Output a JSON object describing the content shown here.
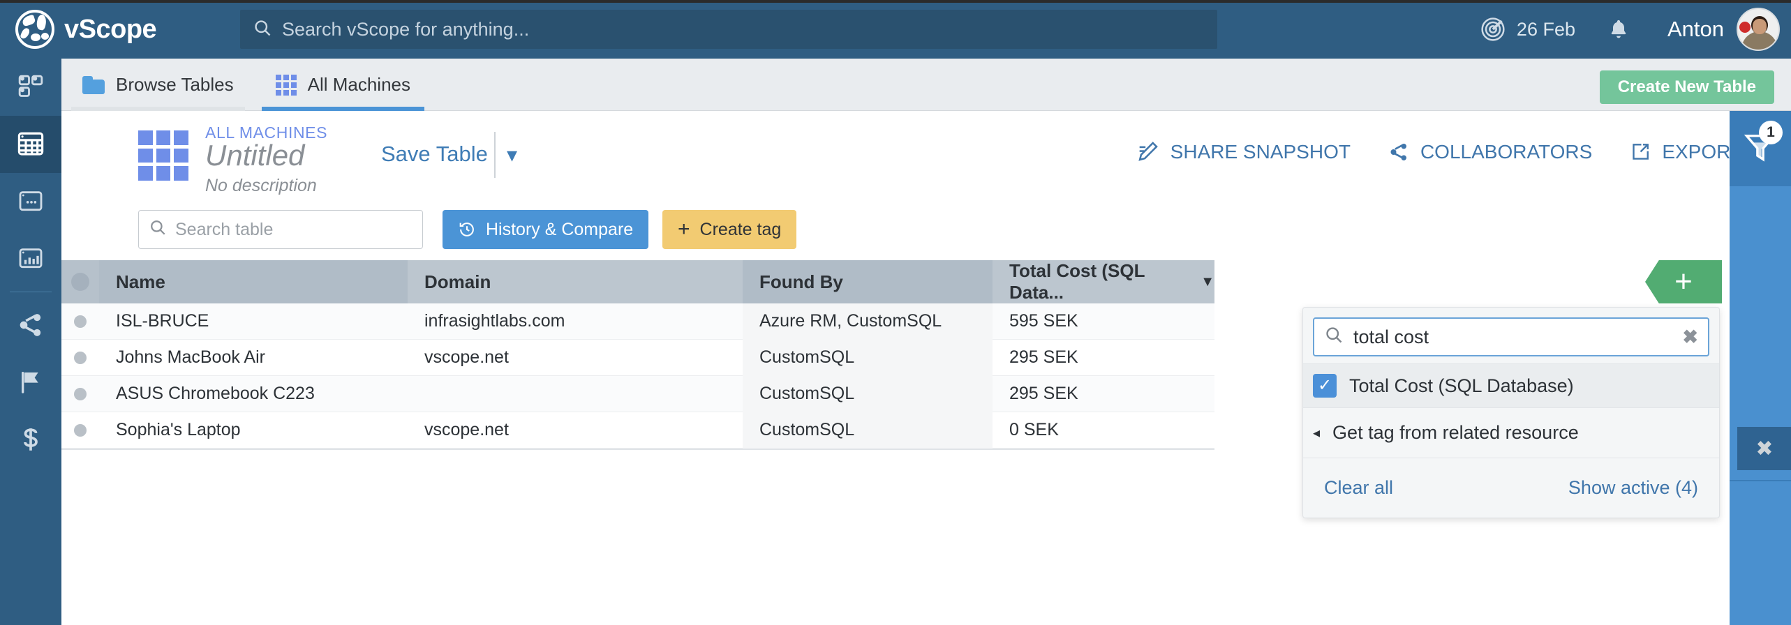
{
  "app": {
    "brand": "vScope",
    "logo_icon": "vscope-globe-logo"
  },
  "header": {
    "search_placeholder": "Search vScope for anything...",
    "search_icon": "search-icon",
    "radar_icon": "radar-icon",
    "date": "26 Feb",
    "bell_icon": "bell-icon",
    "user_name": "Anton",
    "avatar_icon": "user-avatar"
  },
  "sidebar": {
    "items": [
      {
        "name": "dashboard",
        "icon": "dashboard-tiles-icon",
        "active": false
      },
      {
        "name": "tables",
        "icon": "table-grid-icon",
        "active": true
      },
      {
        "name": "reports",
        "icon": "window-dots-icon",
        "active": false
      },
      {
        "name": "analytics",
        "icon": "bar-chart-window-icon",
        "active": false
      },
      {
        "name": "integrations",
        "icon": "share-nodes-icon",
        "active": false
      },
      {
        "name": "issues",
        "icon": "flag-icon",
        "active": false
      },
      {
        "name": "costs",
        "icon": "dollar-icon",
        "active": false
      }
    ]
  },
  "tabbar": {
    "tabs": [
      {
        "label": "Browse Tables",
        "icon": "folder-icon",
        "active": false
      },
      {
        "label": "All Machines",
        "icon": "grid-icon",
        "active": true
      }
    ],
    "create_button": "Create New Table"
  },
  "title_area": {
    "table_icon": "table-grid-icon",
    "breadcrumb": "ALL MACHINES",
    "title": "Untitled",
    "description": "No description",
    "save_label": "Save Table",
    "caret_icon": "chevron-down-icon",
    "actions": [
      {
        "label": "SHARE SNAPSHOT",
        "icon": "share-snapshot-icon"
      },
      {
        "label": "COLLABORATORS",
        "icon": "collaborators-share-icon"
      },
      {
        "label": "EXPORT",
        "icon": "export-icon",
        "caret": "chevron-down-icon"
      }
    ]
  },
  "toolbar": {
    "search_placeholder": "Search table",
    "search_icon": "search-icon",
    "history_label": "History & Compare",
    "history_icon": "history-clock-icon",
    "create_tag_label": "Create tag",
    "create_tag_icon": "plus-icon"
  },
  "table": {
    "columns": [
      {
        "label": "Name",
        "key": "name"
      },
      {
        "label": "Domain",
        "key": "domain"
      },
      {
        "label": "Found By",
        "key": "found_by"
      },
      {
        "label": "Total Cost (SQL Data...",
        "key": "cost",
        "sorted": true,
        "sort_icon": "caret-down-icon"
      }
    ],
    "rows": [
      {
        "name": "ISL-BRUCE",
        "domain": "infrasightlabs.com",
        "found_by": "Azure RM, CustomSQL",
        "cost": "595 SEK"
      },
      {
        "name": "Johns MacBook Air",
        "domain": "vscope.net",
        "found_by": "CustomSQL",
        "cost": "295 SEK"
      },
      {
        "name": "ASUS Chromebook C223",
        "domain": "",
        "found_by": "CustomSQL",
        "cost": "295 SEK"
      },
      {
        "name": "Sophia's Laptop",
        "domain": "vscope.net",
        "found_by": "CustomSQL",
        "cost": "0 SEK"
      }
    ],
    "add_column_icon": "plus-icon"
  },
  "column_picker": {
    "search_value": "total cost",
    "search_icon": "search-icon",
    "clear_icon": "clear-x-icon",
    "options": [
      {
        "label": "Total Cost (SQL Database)",
        "checked": true
      }
    ],
    "related_label": "Get tag from related resource",
    "related_icon": "caret-left-icon",
    "clear_all": "Clear all",
    "show_active": "Show active (4)"
  },
  "right_rail": {
    "filter_icon": "filter-funnel-icon",
    "filter_badge": "1",
    "close_icon": "close-x-icon"
  },
  "colors": {
    "brand_blue": "#2f5d82",
    "accent_blue": "#4b94d6",
    "green": "#74c59b",
    "tag_yellow": "#f2cb72",
    "header_gray": "#b6c1cb",
    "link_blue": "#4076ab",
    "lilac": "#6f8ee8"
  }
}
